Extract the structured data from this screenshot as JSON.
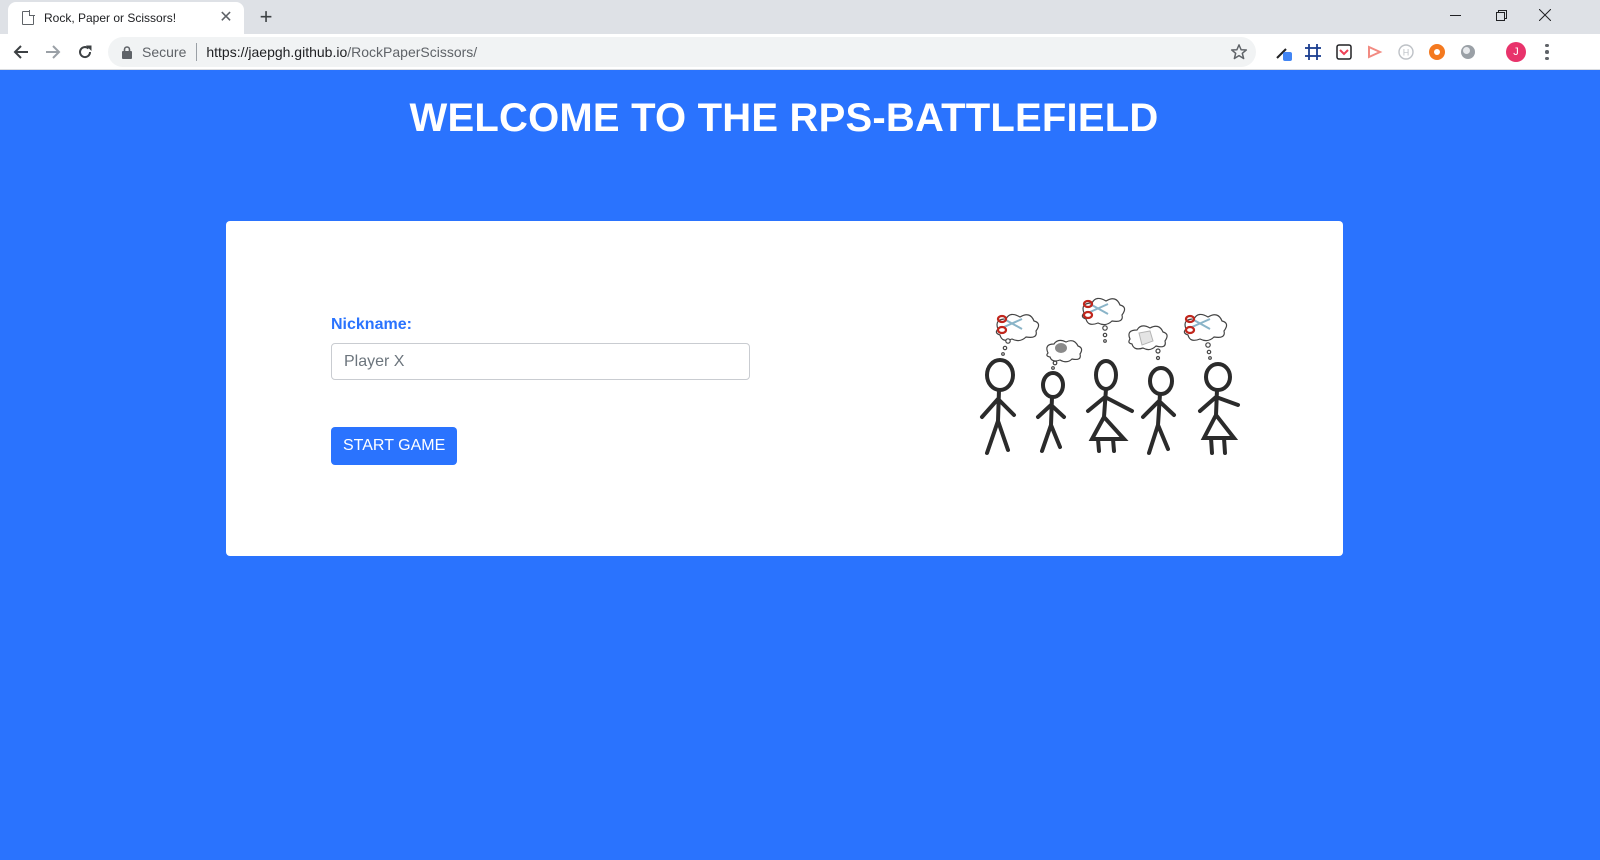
{
  "browser": {
    "tab_title": "Rock, Paper or Scissors!",
    "url_security": "Secure",
    "url_host": "https://jaepgh.github.io",
    "url_path": "/RockPaperScissors/",
    "avatar_letter": "J"
  },
  "page": {
    "heading": "WELCOME TO THE RPS-BATTLEFIELD",
    "nickname_label": "Nickname:",
    "nickname_placeholder": "Player X",
    "nickname_value": "",
    "start_button": "START GAME"
  },
  "colors": {
    "background": "#2a73fe",
    "card": "#ffffff",
    "accent": "#2a73fe"
  },
  "illustration": {
    "figures": [
      {
        "thought": "scissors"
      },
      {
        "thought": "rock"
      },
      {
        "thought": "scissors"
      },
      {
        "thought": "paper"
      },
      {
        "thought": "scissors"
      }
    ]
  }
}
